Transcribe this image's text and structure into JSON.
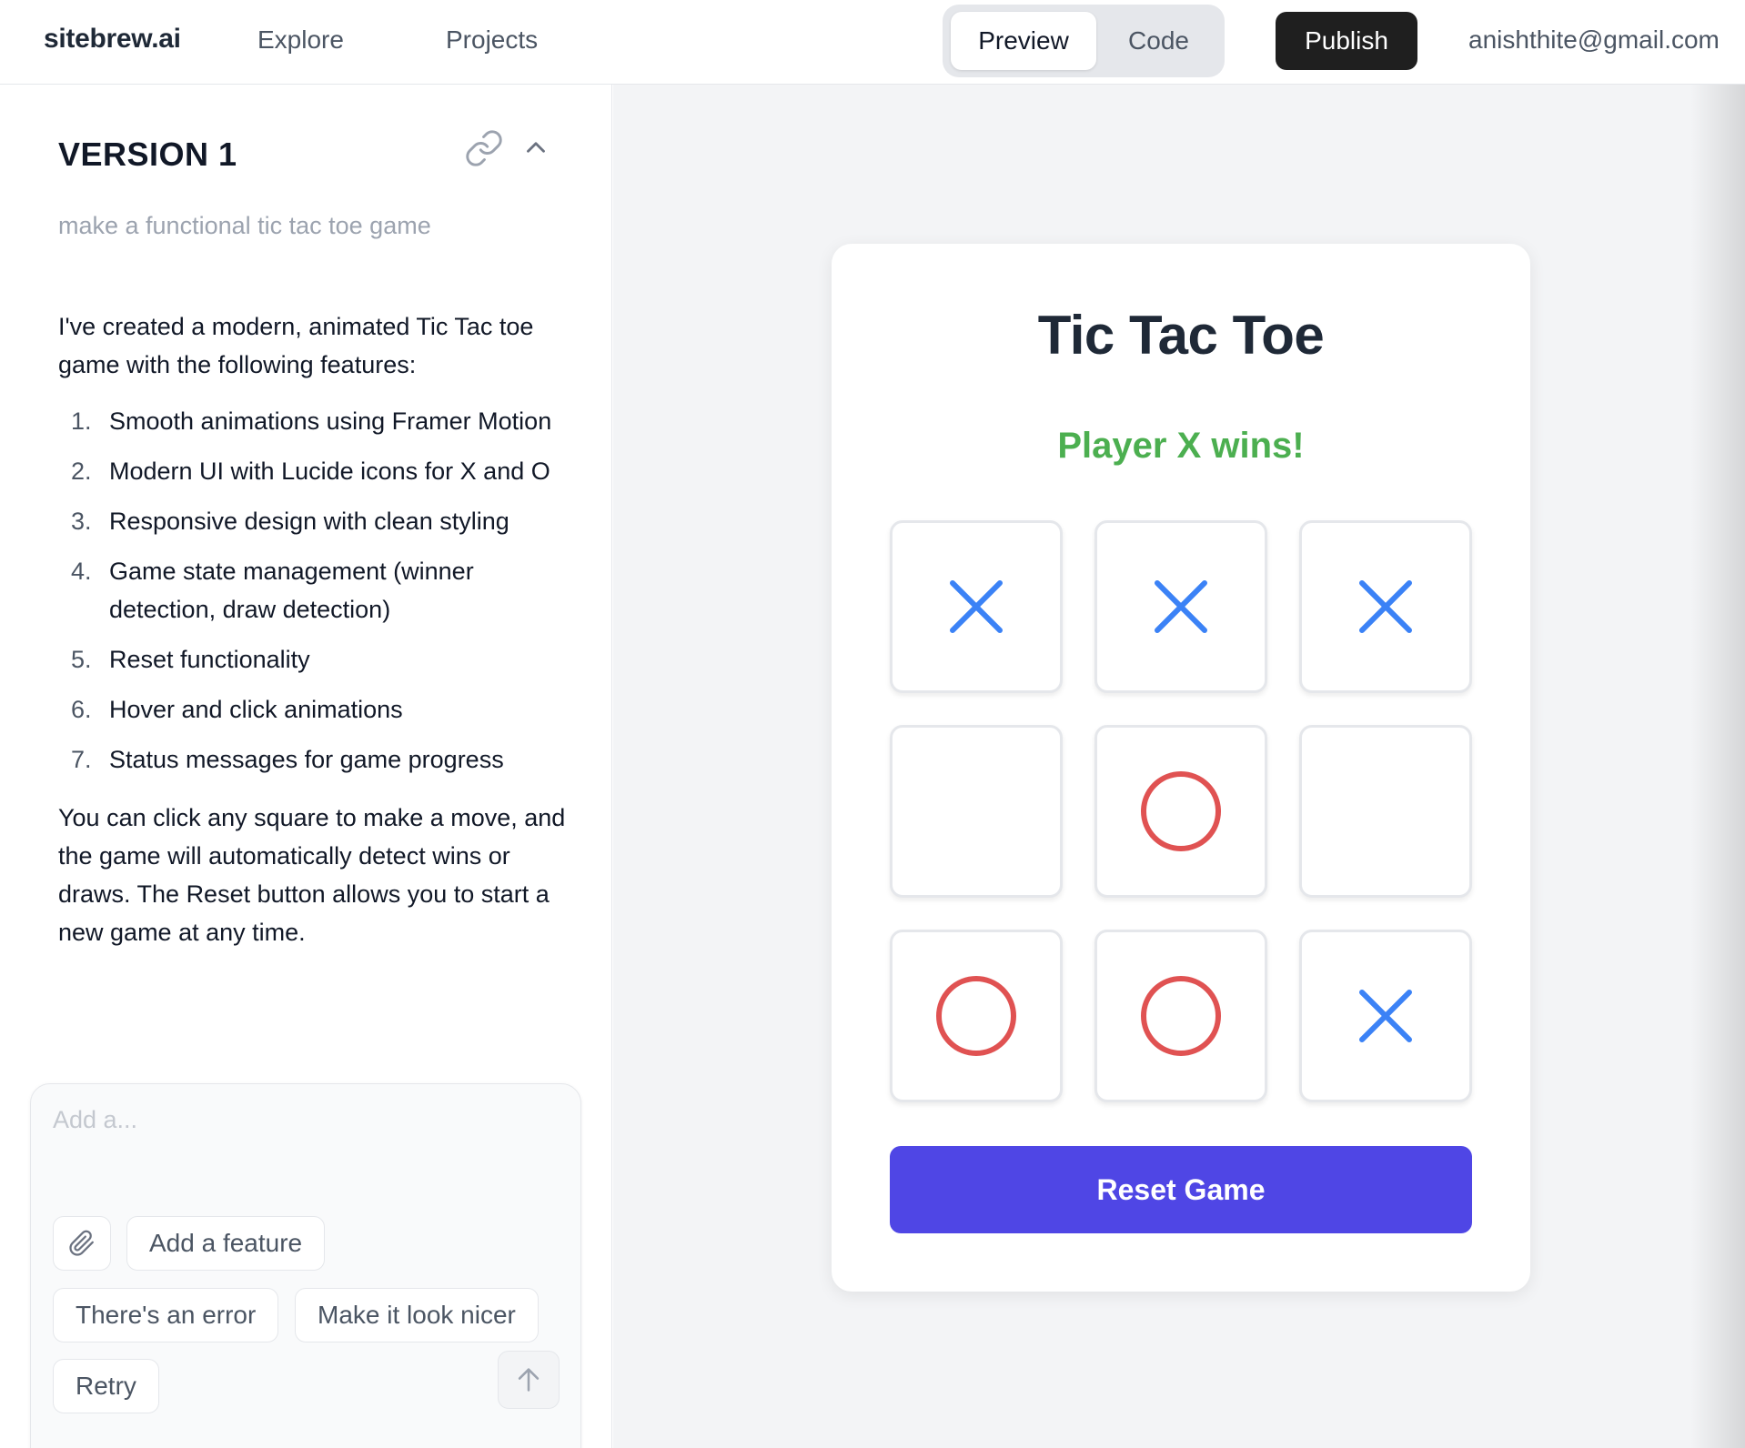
{
  "header": {
    "brand": "sitebrew.ai",
    "nav": [
      "Explore",
      "Projects"
    ],
    "view_toggle": {
      "preview": "Preview",
      "code": "Code",
      "selected": "Preview"
    },
    "publish_label": "Publish",
    "user_email": "anishthite@gmail.com"
  },
  "sidebar": {
    "version_title": "VERSION 1",
    "prompt": "make a functional tic tac toe game",
    "response_intro": "I've created a modern, animated Tic Tac toe game with the following features:",
    "features": [
      {
        "num": "1.",
        "text": "Smooth animations using Framer Motion"
      },
      {
        "num": "2.",
        "text": "Modern UI with Lucide icons for X and O"
      },
      {
        "num": "3.",
        "text": "Responsive design with clean styling"
      },
      {
        "num": "4.",
        "text": "Game state management (winner detection, draw detection)"
      },
      {
        "num": "5.",
        "text": "Reset functionality"
      },
      {
        "num": "6.",
        "text": "Hover and click animations"
      },
      {
        "num": "7.",
        "text": "Status messages for game progress"
      }
    ],
    "response_outro": "You can click any square to make a move, and the game will automatically detect wins or draws. The Reset button allows you to start a new game at any time."
  },
  "composer": {
    "placeholder": "Add a...",
    "value": "",
    "chips": {
      "add_feature": "Add a feature",
      "error": "There's an error",
      "nicer": "Make it look nicer",
      "retry": "Retry"
    }
  },
  "game": {
    "title": "Tic Tac Toe",
    "status": "Player X wins!",
    "board": [
      "X",
      "X",
      "X",
      "",
      "O",
      "",
      "O",
      "O",
      "X"
    ],
    "reset_label": "Reset Game",
    "colors": {
      "x": "#3b82f6",
      "o": "#e05252",
      "status": "#4caf50",
      "reset": "#4f46e5"
    }
  }
}
